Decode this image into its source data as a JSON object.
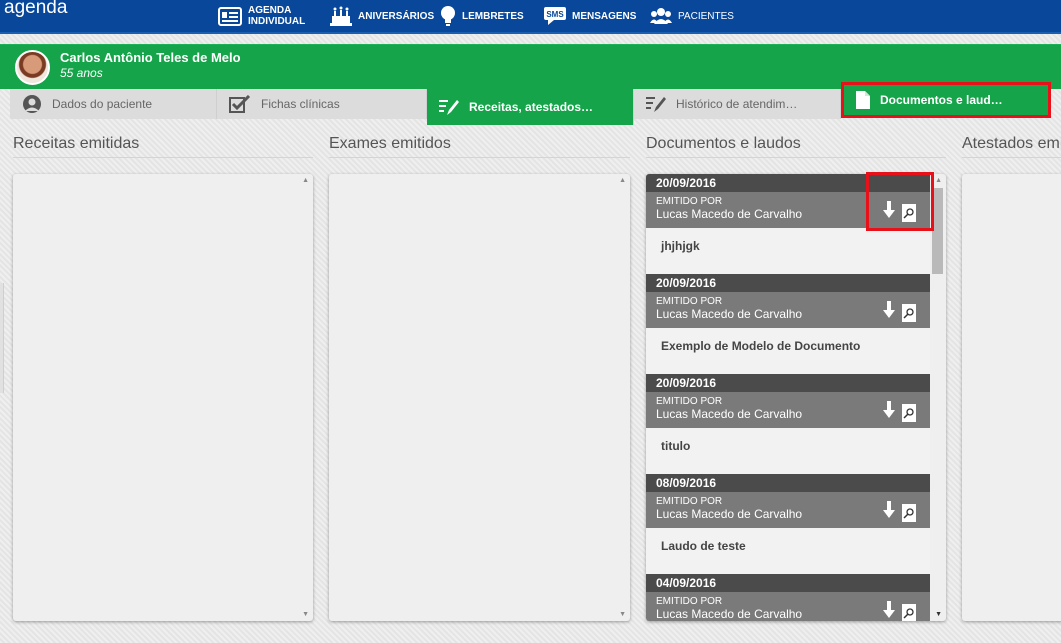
{
  "app": {
    "brand": "agenda"
  },
  "nav": [
    {
      "label_line1": "AGENDA",
      "label_line2": "INDIVIDUAL",
      "icon": "calendar-icon"
    },
    {
      "label": "ANIVERSÁRIOS",
      "icon": "cake-icon"
    },
    {
      "label": "LEMBRETES",
      "icon": "lightbulb-icon"
    },
    {
      "label": "MENSAGENS",
      "icon": "sms-icon",
      "icon_text": "SMS"
    },
    {
      "label": "PACIENTES",
      "icon": "users-icon"
    }
  ],
  "patient": {
    "name": "Carlos Antônio Teles de Melo",
    "age": "55 anos"
  },
  "tabs": [
    {
      "label": "Dados do paciente",
      "icon": "user-icon",
      "active": false
    },
    {
      "label": "Fichas clínicas",
      "icon": "checkbox-icon",
      "active": false
    },
    {
      "label": "Receitas, atestados…",
      "icon": "edit-list-icon",
      "active": true
    },
    {
      "label": "Histórico de atendim…",
      "icon": "edit-list-icon",
      "active": false
    },
    {
      "label": "Documentos e laud…",
      "icon": "document-icon",
      "active": true
    }
  ],
  "columns": {
    "receitas": {
      "title": "Receitas emitidas"
    },
    "exames": {
      "title": "Exames emitidos"
    },
    "documentos": {
      "title": "Documentos e laudos"
    },
    "atestados": {
      "title": "Atestados emitidos"
    }
  },
  "documents": [
    {
      "date": "20/09/2016",
      "issued_by_label": "EMITIDO POR",
      "author": "Lucas Macedo de Carvalho",
      "title": "jhjhjgk"
    },
    {
      "date": "20/09/2016",
      "issued_by_label": "EMITIDO POR",
      "author": "Lucas Macedo de Carvalho",
      "title": "Exemplo de Modelo de Documento"
    },
    {
      "date": "20/09/2016",
      "issued_by_label": "EMITIDO POR",
      "author": "Lucas Macedo de Carvalho",
      "title": "titulo"
    },
    {
      "date": "08/09/2016",
      "issued_by_label": "EMITIDO POR",
      "author": "Lucas Macedo de Carvalho",
      "title": "Laudo de teste"
    },
    {
      "date": "04/09/2016",
      "issued_by_label": "EMITIDO POR",
      "author": "Lucas Macedo de Carvalho",
      "title": ""
    }
  ],
  "colors": {
    "topbar": "#08479a",
    "green": "#16a44a",
    "highlight": "#e8111a"
  }
}
